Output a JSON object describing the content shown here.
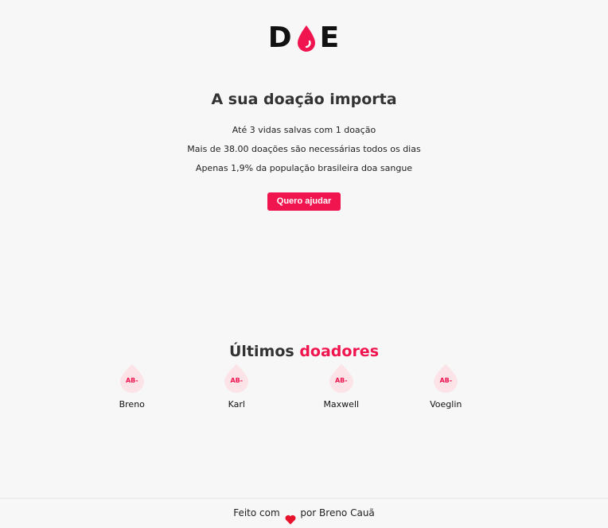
{
  "brand": {
    "logo_letter_left": "D",
    "logo_letter_right": "E",
    "accent_color": "#f0144f",
    "logo_icon": "blood-drop-icon"
  },
  "hero": {
    "title": "A sua doação importa",
    "lines": [
      "Até 3 vidas salvas com 1 doação",
      "Mais de 38.00 doações são necessárias todos os dias",
      "Apenas 1,9% da população brasileira doa sangue"
    ],
    "cta_label": "Quero ajudar"
  },
  "donors_section": {
    "title_prefix": "Últimos",
    "title_accent": "doadores",
    "donors": [
      {
        "name": "Breno",
        "blood_type": "AB-"
      },
      {
        "name": "Karl",
        "blood_type": "AB-"
      },
      {
        "name": "Maxwell",
        "blood_type": "AB-"
      },
      {
        "name": "Voeglin",
        "blood_type": "AB-"
      }
    ]
  },
  "footer": {
    "text_before": "Feito com",
    "text_after": "por Breno Cauã",
    "icon": "heart-icon"
  }
}
